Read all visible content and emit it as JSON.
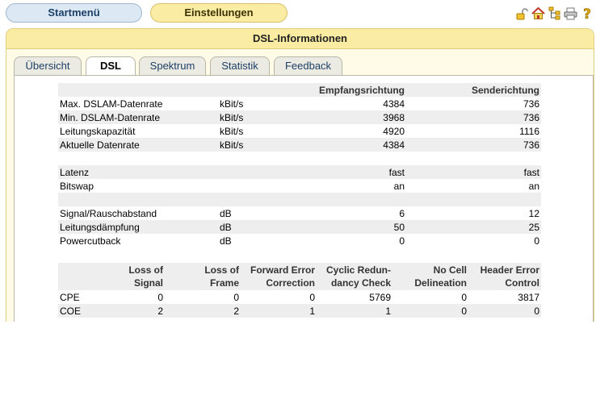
{
  "nav": {
    "start": "Startmenü",
    "settings": "Einstellungen"
  },
  "icons": [
    "lock-icon",
    "home-icon",
    "sitemap-icon",
    "printer-icon",
    "help-icon"
  ],
  "panel": {
    "title": "DSL-Informationen"
  },
  "tabs": [
    "Übersicht",
    "DSL",
    "Spektrum",
    "Statistik",
    "Feedback"
  ],
  "active_tab": "DSL",
  "dsl_table": {
    "headers": [
      "",
      "",
      "Empfangsrichtung",
      "Senderichtung"
    ],
    "rows": [
      [
        "Max. DSLAM-Datenrate",
        "kBit/s",
        "4384",
        "736"
      ],
      [
        "Min. DSLAM-Datenrate",
        "kBit/s",
        "3968",
        "736"
      ],
      [
        "Leitungskapazität",
        "kBit/s",
        "4920",
        "1116"
      ],
      [
        "Aktuelle Datenrate",
        "kBit/s",
        "4384",
        "736"
      ],
      [
        "",
        "",
        "",
        ""
      ],
      [
        "Latenz",
        "",
        "fast",
        "fast"
      ],
      [
        "Bitswap",
        "",
        "an",
        "an"
      ],
      [
        "",
        "",
        "",
        ""
      ],
      [
        "Signal/Rauschabstand",
        "dB",
        "6",
        "12"
      ],
      [
        "Leitungsdämpfung",
        "dB",
        "50",
        "25"
      ],
      [
        "Powercutback",
        "dB",
        "0",
        "0"
      ]
    ]
  },
  "error_table": {
    "headers": [
      [
        "",
        ""
      ],
      [
        "Loss of",
        "Signal"
      ],
      [
        "Loss of",
        "Frame"
      ],
      [
        "Forward Error",
        "Correction"
      ],
      [
        "Cyclic Redun-",
        "dancy Check"
      ],
      [
        "No Cell",
        "Delineation"
      ],
      [
        "Header Error",
        "Control"
      ]
    ],
    "rows": [
      [
        "CPE",
        "0",
        "0",
        "0",
        "5769",
        "0",
        "3817"
      ],
      [
        "COE",
        "2",
        "2",
        "1",
        "1",
        "0",
        "0"
      ]
    ]
  }
}
